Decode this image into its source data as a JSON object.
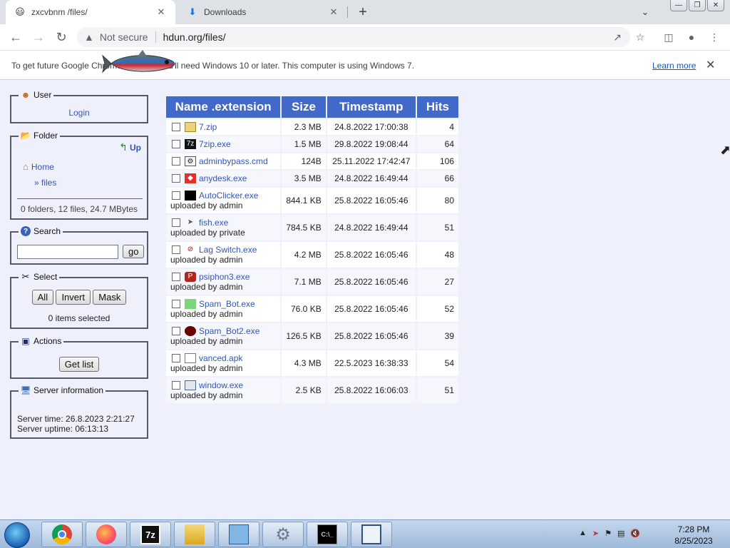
{
  "browser": {
    "tabs": [
      {
        "title": "zxcvbnm /files/",
        "favicon": "smiley-icon"
      },
      {
        "title": "Downloads",
        "favicon": "download-icon"
      }
    ],
    "address": {
      "security": "Not secure",
      "url": "hdun.org/files/"
    },
    "infobar": {
      "message": "To get future Google Chrome updates, you'll need Windows 10 or later. This computer is using Windows 7.",
      "learn_more": "Learn more"
    }
  },
  "sidebar": {
    "user": {
      "title": "User",
      "login": "Login"
    },
    "folder": {
      "title": "Folder",
      "up": "Up",
      "home": "Home",
      "current": "» files",
      "stats": "0 folders, 12 files, 24.7 MBytes"
    },
    "search": {
      "title": "Search",
      "go": "go",
      "value": ""
    },
    "select": {
      "title": "Select",
      "all": "All",
      "invert": "Invert",
      "mask": "Mask",
      "count": "0 items selected"
    },
    "actions": {
      "title": "Actions",
      "get_list": "Get list"
    },
    "server": {
      "title": "Server information",
      "time": "Server time: 26.8.2023 2:21:27",
      "uptime": "Server uptime: 06:13:13"
    }
  },
  "table": {
    "headers": {
      "name": "Name .extension",
      "size": "Size",
      "timestamp": "Timestamp",
      "hits": "Hits"
    },
    "rows": [
      {
        "name": "7.zip",
        "uploader": "",
        "size": "2.3 MB",
        "timestamp": "24.8.2022 17:00:38",
        "hits": "4"
      },
      {
        "name": "7zip.exe",
        "uploader": "",
        "size": "1.5 MB",
        "timestamp": "29.8.2022 19:08:44",
        "hits": "64"
      },
      {
        "name": "adminbypass.cmd",
        "uploader": "",
        "size": "124B",
        "timestamp": "25.11.2022 17:42:47",
        "hits": "106"
      },
      {
        "name": "anydesk.exe",
        "uploader": "",
        "size": "3.5 MB",
        "timestamp": "24.8.2022 16:49:44",
        "hits": "66"
      },
      {
        "name": "AutoClicker.exe",
        "uploader": "uploaded by admin",
        "size": "844.1 KB",
        "timestamp": "25.8.2022 16:05:46",
        "hits": "80"
      },
      {
        "name": "fish.exe",
        "uploader": "uploaded by private",
        "size": "784.5 KB",
        "timestamp": "24.8.2022 16:49:44",
        "hits": "51"
      },
      {
        "name": "Lag Switch.exe",
        "uploader": "uploaded by admin",
        "size": "4.2 MB",
        "timestamp": "25.8.2022 16:05:46",
        "hits": "48"
      },
      {
        "name": "psiphon3.exe",
        "uploader": "uploaded by admin",
        "size": "7.1 MB",
        "timestamp": "25.8.2022 16:05:46",
        "hits": "27"
      },
      {
        "name": "Spam_Bot.exe",
        "uploader": "uploaded by admin",
        "size": "76.0 KB",
        "timestamp": "25.8.2022 16:05:46",
        "hits": "52"
      },
      {
        "name": "Spam_Bot2.exe",
        "uploader": "uploaded by admin",
        "size": "126.5 KB",
        "timestamp": "25.8.2022 16:05:46",
        "hits": "39"
      },
      {
        "name": "vanced.apk",
        "uploader": "uploaded by admin",
        "size": "4.3 MB",
        "timestamp": "22.5.2023 16:38:33",
        "hits": "54"
      },
      {
        "name": "window.exe",
        "uploader": "uploaded by admin",
        "size": "2.5 KB",
        "timestamp": "25.8.2022 16:06:03",
        "hits": "51"
      }
    ]
  },
  "taskbar": {
    "clock": {
      "time": "7:28 PM",
      "date": "8/25/2023"
    }
  },
  "colors": {
    "header_blue": "#4169c9",
    "link_blue": "#3455b5",
    "page_bg": "#eef0fb"
  }
}
